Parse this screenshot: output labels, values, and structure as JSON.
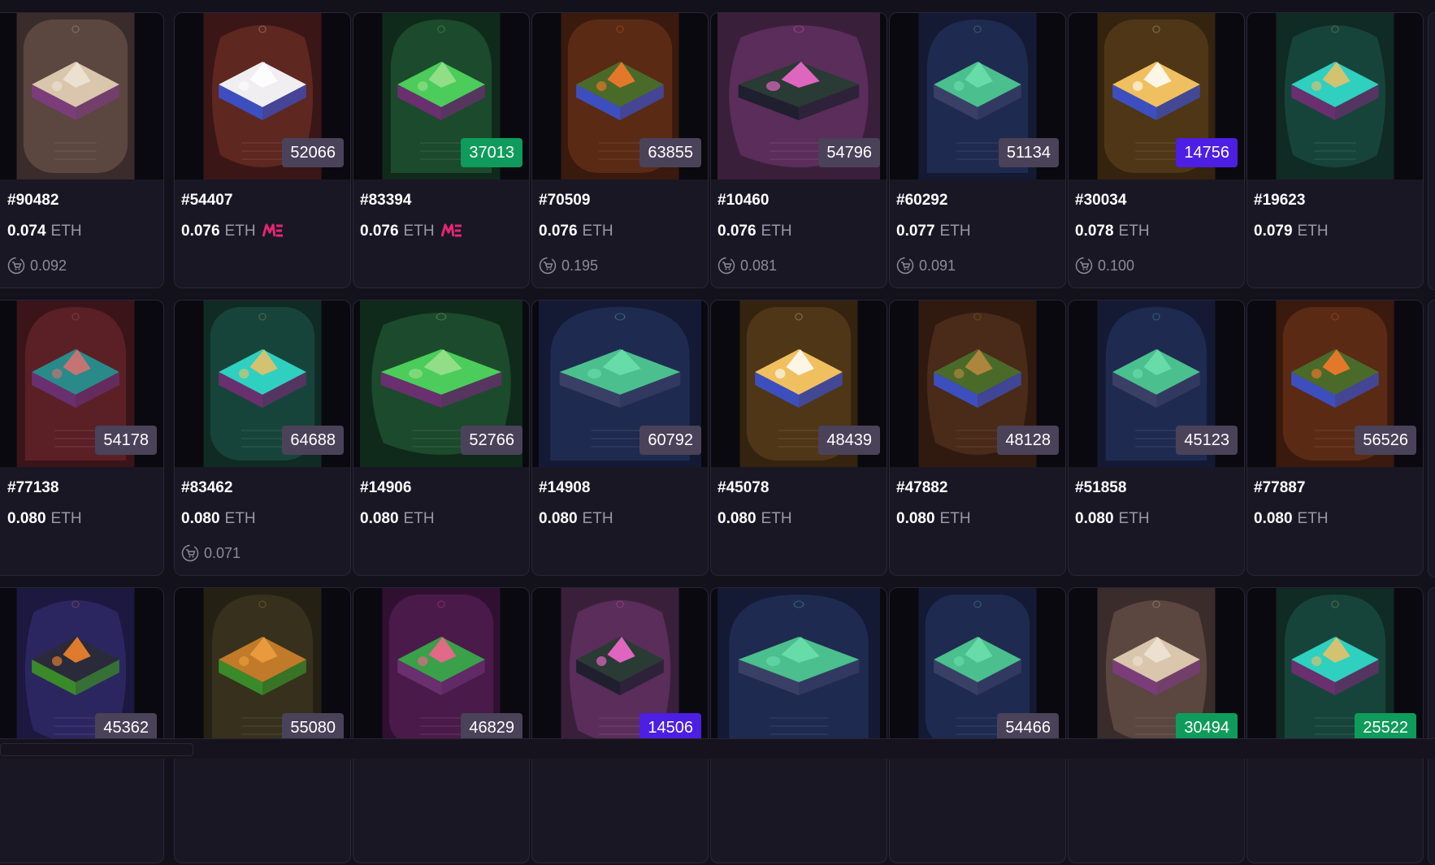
{
  "colors": {
    "badge_default": "#4a4259",
    "badge_green": "#0f9b5b",
    "badge_purple": "#4d1ee3",
    "me_logo": "#e42575"
  },
  "currency": "ETH",
  "cards": [
    {
      "id": "#90482",
      "price": "0.074",
      "offer": "0.092",
      "badge": null,
      "me": false,
      "theme": "bone"
    },
    {
      "id": "#54407",
      "price": "0.076",
      "offer": null,
      "badge": "52066",
      "badge_color": "default",
      "me": true,
      "theme": "red"
    },
    {
      "id": "#83394",
      "price": "0.076",
      "offer": null,
      "badge": "37013",
      "badge_color": "green",
      "me": true,
      "theme": "green"
    },
    {
      "id": "#70509",
      "price": "0.076",
      "offer": "0.195",
      "badge": "63855",
      "badge_color": "default",
      "me": false,
      "theme": "amber"
    },
    {
      "id": "#10460",
      "price": "0.076",
      "offer": "0.081",
      "badge": "54796",
      "badge_color": "default",
      "me": false,
      "theme": "purple"
    },
    {
      "id": "#60292",
      "price": "0.077",
      "offer": "0.091",
      "badge": "51134",
      "badge_color": "default",
      "me": false,
      "theme": "blue"
    },
    {
      "id": "#30034",
      "price": "0.078",
      "offer": "0.100",
      "badge": "14756",
      "badge_color": "purple",
      "me": false,
      "theme": "gold"
    },
    {
      "id": "#19623",
      "price": "0.079",
      "offer": null,
      "badge": null,
      "me": false,
      "theme": "teal"
    },
    {
      "id": "#77138",
      "price": "0.080",
      "offer": null,
      "badge": "54178",
      "badge_color": "default",
      "me": false,
      "theme": "crimson"
    },
    {
      "id": "#83462",
      "price": "0.080",
      "offer": "0.071",
      "badge": "64688",
      "badge_color": "default",
      "me": false,
      "theme": "teal"
    },
    {
      "id": "#14906",
      "price": "0.080",
      "offer": null,
      "badge": "52766",
      "badge_color": "default",
      "me": false,
      "theme": "green"
    },
    {
      "id": "#14908",
      "price": "0.080",
      "offer": null,
      "badge": "60792",
      "badge_color": "default",
      "me": false,
      "theme": "blue"
    },
    {
      "id": "#45078",
      "price": "0.080",
      "offer": null,
      "badge": "48439",
      "badge_color": "default",
      "me": false,
      "theme": "gold"
    },
    {
      "id": "#47882",
      "price": "0.080",
      "offer": null,
      "badge": "48128",
      "badge_color": "default",
      "me": false,
      "theme": "brown"
    },
    {
      "id": "#51858",
      "price": "0.080",
      "offer": null,
      "badge": "45123",
      "badge_color": "default",
      "me": false,
      "theme": "blue"
    },
    {
      "id": "#77887",
      "price": "0.080",
      "offer": null,
      "badge": "56526",
      "badge_color": "default",
      "me": false,
      "theme": "amber"
    },
    {
      "id": null,
      "price": null,
      "offer": null,
      "badge": "45362",
      "badge_color": "default",
      "me": false,
      "theme": "indigo"
    },
    {
      "id": null,
      "price": null,
      "offer": null,
      "badge": "55080",
      "badge_color": "default",
      "me": false,
      "theme": "olive"
    },
    {
      "id": null,
      "price": null,
      "offer": null,
      "badge": "46829",
      "badge_color": "default",
      "me": false,
      "theme": "magenta"
    },
    {
      "id": null,
      "price": null,
      "offer": null,
      "badge": "14506",
      "badge_color": "purple",
      "me": false,
      "theme": "purple"
    },
    {
      "id": null,
      "price": null,
      "offer": null,
      "badge": null,
      "me": false,
      "theme": "blue"
    },
    {
      "id": null,
      "price": null,
      "offer": null,
      "badge": "54466",
      "badge_color": "default",
      "me": false,
      "theme": "blue"
    },
    {
      "id": null,
      "price": null,
      "offer": null,
      "badge": "30494",
      "badge_color": "green",
      "me": false,
      "theme": "bone"
    },
    {
      "id": null,
      "price": null,
      "offer": null,
      "badge": "25522",
      "badge_color": "green",
      "me": false,
      "theme": "teal"
    }
  ]
}
